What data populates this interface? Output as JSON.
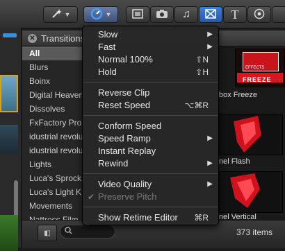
{
  "toolbar": {
    "wand_icon": "magic-wand-icon",
    "retime_icon": "retime-speedometer-icon",
    "tools": [
      "film-strip-icon",
      "camera-icon",
      "music-note-icon",
      "transitions-icon",
      "title-T-icon",
      "generator-icon"
    ],
    "title_glyph": "T"
  },
  "panel": {
    "title": "Transitions",
    "categories": [
      "All",
      "Blurs",
      "Boinx",
      "Digital Heaven",
      "Dissolves",
      "FxFactory Pro",
      "idustrial revolu",
      "idustrial revolu",
      "Lights",
      "Luca's Sprock",
      "Luca's Light K",
      "Movements",
      "Nattress Film"
    ],
    "selected_index": 0
  },
  "tiles": {
    "labels": [
      "box Freeze",
      "nel Flash",
      "nel Vertical"
    ],
    "badge_text": "EFFECTS",
    "freeze_text": "FREEZE"
  },
  "bottom": {
    "item_count": "373 items",
    "search_icon": "search-icon"
  },
  "menu": {
    "items": [
      {
        "label": "Slow",
        "submenu": true
      },
      {
        "label": "Fast",
        "submenu": true
      },
      {
        "label": "Normal 100%",
        "shortcut": "⇧N"
      },
      {
        "label": "Hold",
        "shortcut": "⇧H"
      },
      {
        "separator": true
      },
      {
        "label": "Reverse Clip"
      },
      {
        "label": "Reset Speed",
        "shortcut": "⌥⌘R"
      },
      {
        "separator": true
      },
      {
        "label": "Conform Speed"
      },
      {
        "label": "Speed Ramp",
        "submenu": true
      },
      {
        "label": "Instant Replay"
      },
      {
        "label": "Rewind",
        "submenu": true
      },
      {
        "separator": true
      },
      {
        "label": "Video Quality",
        "submenu": true
      },
      {
        "label": "Preserve Pitch",
        "checked": true,
        "disabled": true
      },
      {
        "separator": true
      },
      {
        "label": "Show Retime Editor",
        "shortcut": "⌘R"
      }
    ]
  }
}
